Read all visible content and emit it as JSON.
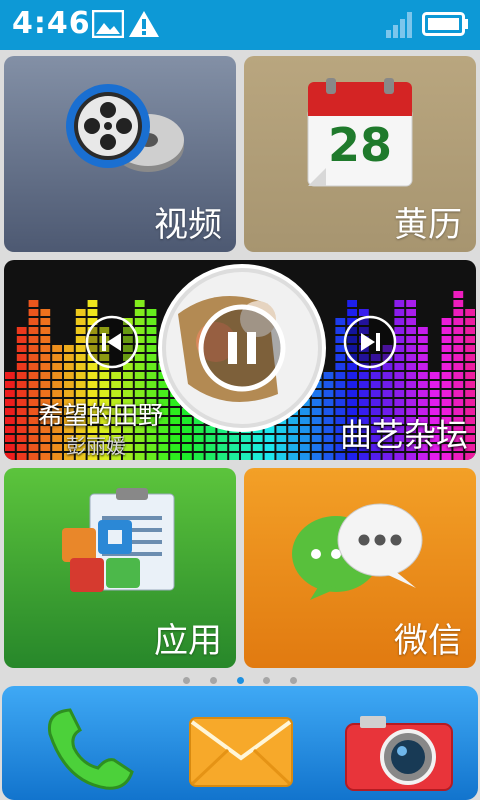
{
  "status_bar": {
    "time": "4:46",
    "notification_icons": [
      "image-icon",
      "warning-icon"
    ],
    "signal_icon": "signal-icon",
    "battery_icon": "battery-icon"
  },
  "tiles": {
    "video": {
      "label": "视频",
      "icon": "film-reel-icon",
      "color": "#6c7890"
    },
    "calendar": {
      "label": "黄历",
      "day": "28",
      "icon": "calendar-icon",
      "color": "#b3a07a"
    },
    "music": {
      "label": "曲艺杂坛",
      "song_title": "希望的田野",
      "artist": "彭丽媛",
      "controls": [
        "previous-icon",
        "pause-icon",
        "next-icon"
      ]
    },
    "apps": {
      "label": "应用",
      "icon": "apps-icon",
      "color": "#3da834"
    },
    "wechat": {
      "label": "微信",
      "icon": "chat-bubbles-icon",
      "color": "#ef8a1a"
    }
  },
  "page_indicator": {
    "count": 5,
    "active_index": 2
  },
  "dock": {
    "items": [
      "phone-icon",
      "mail-icon",
      "camera-icon"
    ]
  },
  "colors": {
    "status_bar": "#0d99d6",
    "dock": "#1b86dc",
    "background": "#dcdcdc"
  }
}
